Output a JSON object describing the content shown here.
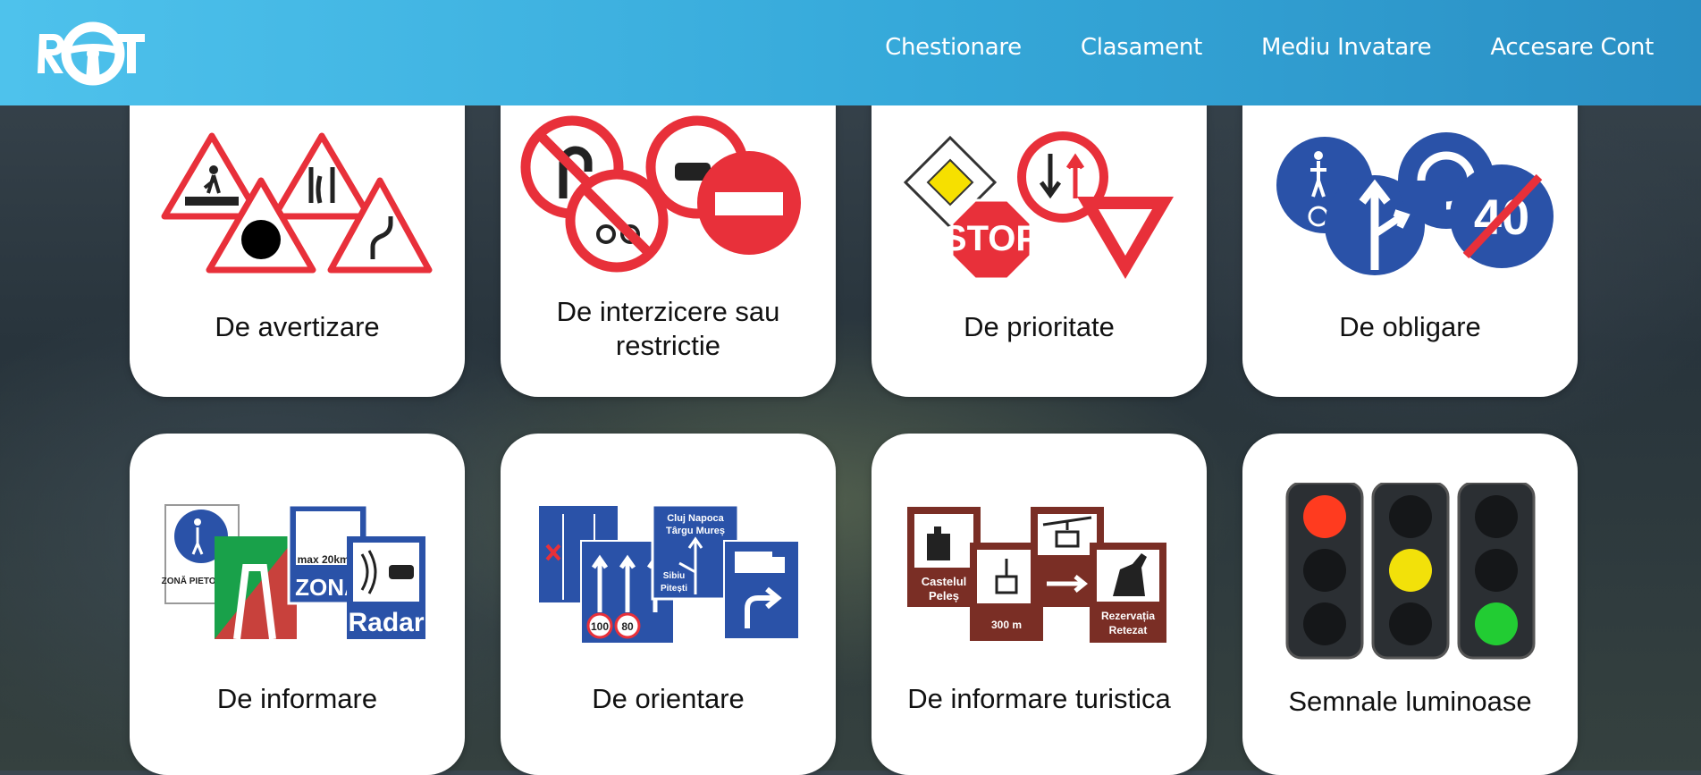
{
  "header": {
    "logo_text": "ROT",
    "nav": [
      {
        "label": "Chestionare"
      },
      {
        "label": "Clasament"
      },
      {
        "label": "Mediu Invatare"
      },
      {
        "label": "Accesare Cont"
      }
    ]
  },
  "categories": [
    {
      "label": "De avertizare"
    },
    {
      "label": "De interzicere sau restrictie"
    },
    {
      "label": "De prioritate"
    },
    {
      "label": "De obligare"
    },
    {
      "label": "De informare"
    },
    {
      "label": "De orientare"
    },
    {
      "label": "De informare turistica"
    },
    {
      "label": "Semnale luminoase"
    }
  ],
  "sign_texts": {
    "stop": "STOP",
    "speed_40": "40",
    "max_20km": "max 20km/h",
    "zona": "ZONA",
    "radar": "Radar",
    "zona_pietonala": "ZONĂ PIETONALĂ",
    "speed_100": "100",
    "speed_80": "80",
    "cluj": "Cluj Napoca",
    "targu": "Târgu Mureș",
    "sibiu": "Sibiu",
    "pitesti": "Pitești",
    "castelul": "Castelul",
    "peles": "Peleș",
    "altitude": "300 m",
    "rezervatia": "Rezervația",
    "retezat": "Retezat"
  },
  "colors": {
    "nav_start": "#4ec2ec",
    "nav_end": "#2a8fc4",
    "warning_red": "#e8303a",
    "mandatory_blue": "#2a52a8",
    "tourist_brown": "#7a2e25",
    "priority_yellow": "#f6e000",
    "light_red": "#ff3b1f",
    "light_yellow": "#f2e10a",
    "light_green": "#22cc33"
  }
}
